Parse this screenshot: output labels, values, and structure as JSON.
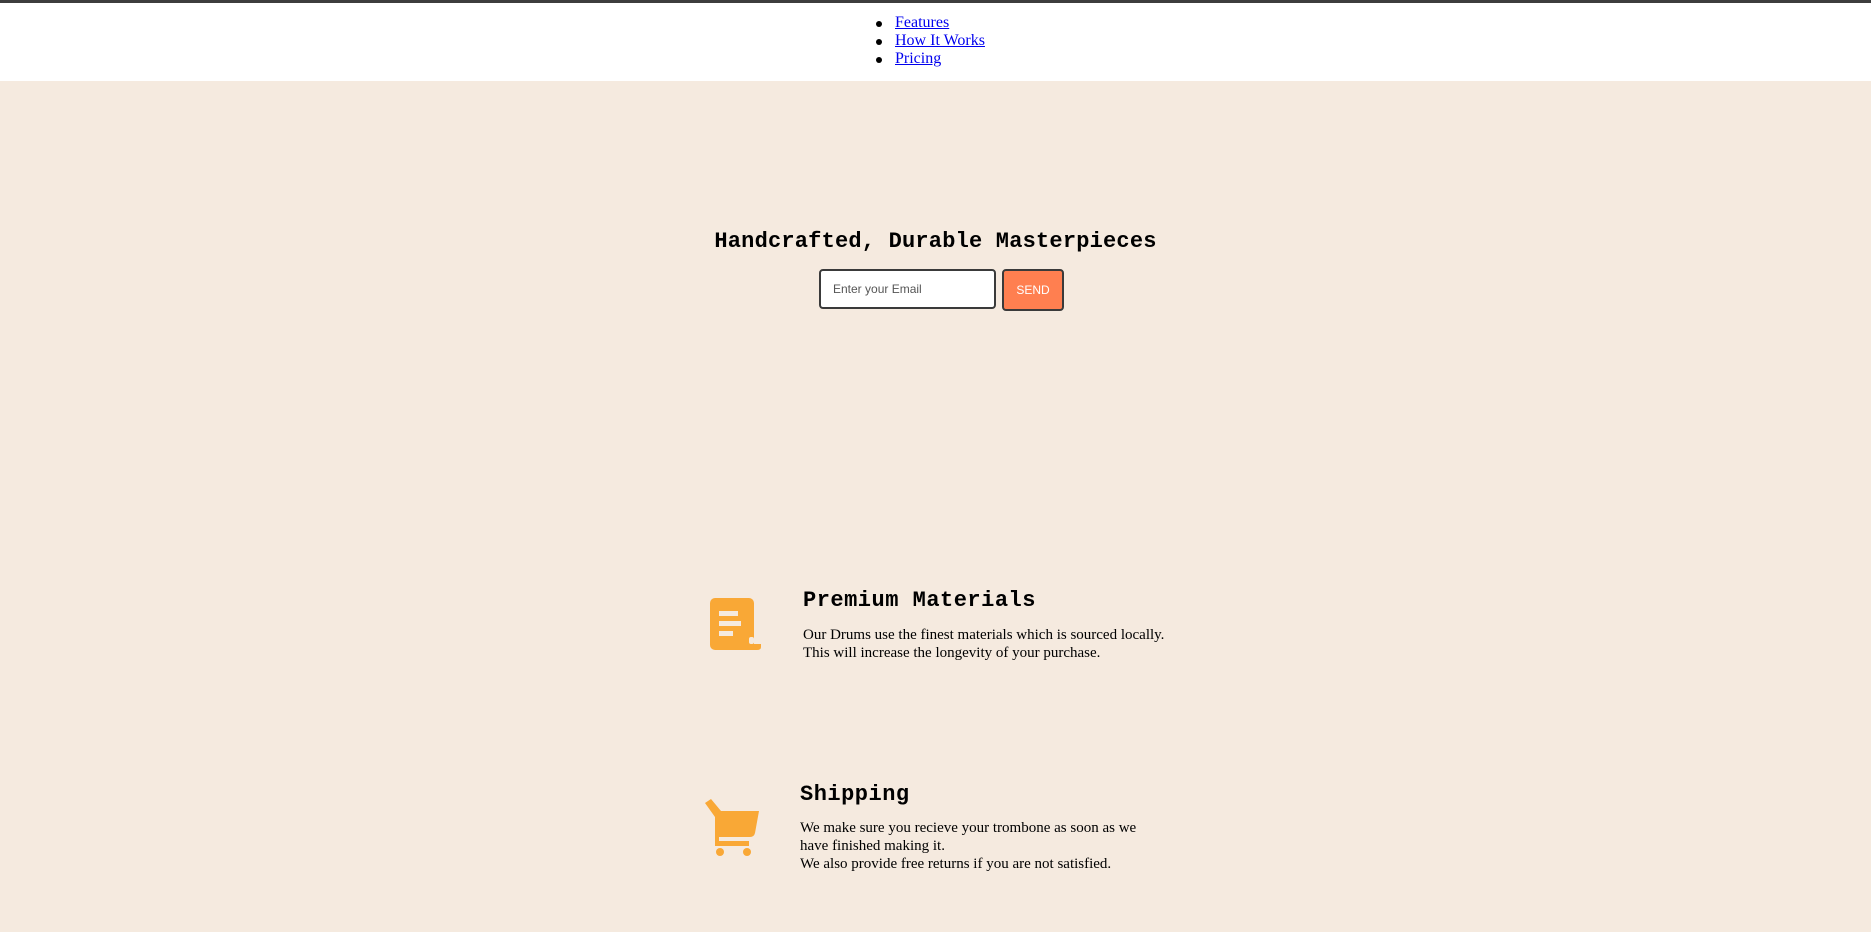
{
  "nav": {
    "items": [
      {
        "label": "Features"
      },
      {
        "label": "How It Works"
      },
      {
        "label": "Pricing"
      }
    ]
  },
  "hero": {
    "title": "Handcrafted, Durable Masterpieces",
    "email_placeholder": "Enter your Email",
    "send_label": "SEND"
  },
  "features": [
    {
      "icon": "receipt-icon",
      "title": "Premium Materials",
      "lines": [
        "Our Drums use the finest materials which is sourced locally.",
        "This will increase the longevity of your purchase."
      ]
    },
    {
      "icon": "cart-icon",
      "title": "Shipping",
      "lines": [
        "We make sure you recieve your trombone as soon as we",
        "have finished making it.",
        "We also provide free returns if you are not satisfied."
      ]
    }
  ],
  "colors": {
    "background": "#f5eadf",
    "accent": "#ff7f50",
    "icon": "#f9a836",
    "link": "#0000ee"
  }
}
